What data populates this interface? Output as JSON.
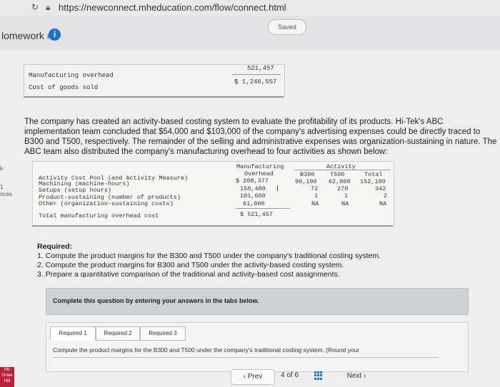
{
  "browser": {
    "url": "https://newconnect.mheducation.com/flow/connect.html"
  },
  "header": {
    "title": "lomework #2",
    "info_glyph": "i",
    "saved_label": "Saved"
  },
  "summary_table": {
    "rows": [
      {
        "label": "Manufacturing overhead",
        "value": "521,457"
      },
      {
        "label": "Cost of goods sold",
        "value": "$ 1,246,557"
      }
    ]
  },
  "paragraph": "The company has created an activity-based costing system to evaluate the profitability of its products. Hi-Tek's ABC implementation team concluded that $54,000 and $103,000 of the company's advertising expenses could be directly traced to B300 and T500, respectively. The remainder of the selling and administrative expenses was organization-sustaining in nature. The ABC team also distributed the company's manufacturing overhead to four activities as shown below:",
  "abc_table": {
    "col_headers": {
      "pool": "Activity Cost Pool (and Activity Measure)",
      "mfg_overhead_1": "Manufacturing",
      "mfg_overhead_2": "Overhead",
      "activity": "Activity",
      "b300": "B300",
      "t500": "T500",
      "total": "Total"
    },
    "rows": [
      {
        "pool": "Machining (machine-hours)",
        "overhead": "$ 208,377",
        "b300": "90,100",
        "t500": "62,000",
        "total": "152,100"
      },
      {
        "pool": "Setups (setup hours)",
        "overhead": "150,480",
        "b300": "72",
        "t500": "270",
        "total": "342"
      },
      {
        "pool": "Product-sustaining (number of products)",
        "overhead": "101,600",
        "b300": "1",
        "t500": "1",
        "total": "2"
      },
      {
        "pool": "Other (organization-sustaining costs)",
        "overhead": "61,000",
        "b300": "NA",
        "t500": "NA",
        "total": "NA"
      },
      {
        "pool": "Total manufacturing overhead cost",
        "overhead": "$ 521,457",
        "b300": "",
        "t500": "",
        "total": ""
      }
    ],
    "cursor_glyph": "I"
  },
  "required": {
    "heading": "Required:",
    "items": [
      "1. Compute the product margins for the B300 and T500 under the company's traditional costing system.",
      "2. Compute the product margins for B300 and T500 under the activity-based costing system.",
      "3. Prepare a quantitative comparison of the traditional and activity-based cost assignments."
    ]
  },
  "hint": "Complete this question by entering your answers in the tabs below.",
  "tabs": [
    {
      "label": "Required 1",
      "active": true
    },
    {
      "label": "Required 2",
      "active": false
    },
    {
      "label": "Required 3",
      "active": false
    }
  ],
  "tab_content": "Compute the product margins for the B300 and T500 under the company's traditional costing system. (Round your",
  "nav": {
    "prev_label": "Prev",
    "page": "4",
    "of_label": "of",
    "total": "6",
    "next_label": "Next"
  },
  "side_marks": [
    "k",
    "1",
    "nces"
  ],
  "badge_text": "Mc Graw Hill",
  "colors": {
    "accent": "#1a73c8",
    "badge": "#b8233a"
  }
}
